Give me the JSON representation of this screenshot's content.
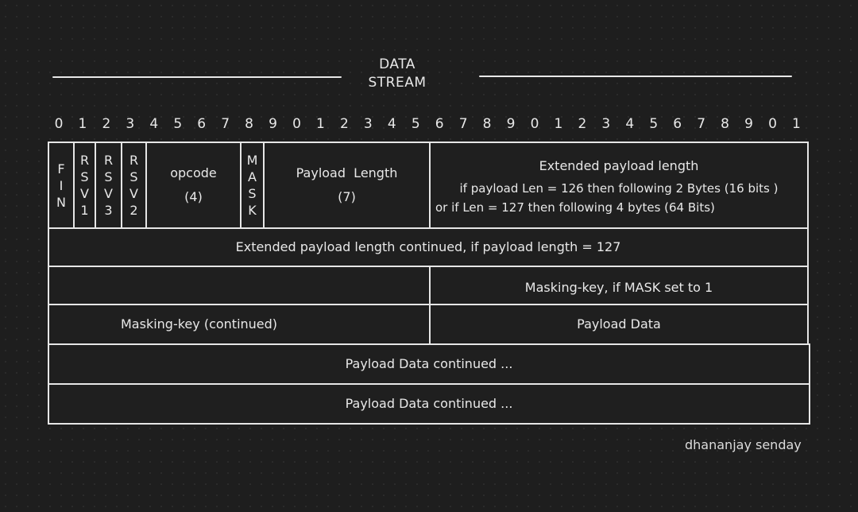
{
  "title": {
    "line1": "DATA",
    "line2": "STREAM"
  },
  "bit_labels": [
    "0",
    "1",
    "2",
    "3",
    "4",
    "5",
    "6",
    "7",
    "8",
    "9",
    "0",
    "1",
    "2",
    "3",
    "4",
    "5",
    "6",
    "7",
    "8",
    "9",
    "0",
    "1",
    "2",
    "3",
    "4",
    "5",
    "6",
    "7",
    "8",
    "9",
    "0",
    "1"
  ],
  "row1": {
    "fin": [
      "F",
      "I",
      "N"
    ],
    "rsv1": [
      "R",
      "S",
      "V",
      "1"
    ],
    "rsv3": [
      "R",
      "S",
      "V",
      "3"
    ],
    "rsv2": [
      "R",
      "S",
      "V",
      "2"
    ],
    "opcode": {
      "name": "opcode",
      "bits": "(4)"
    },
    "mask": [
      "M",
      "A",
      "S",
      "K"
    ],
    "payload_length": {
      "name": "Payload  Length",
      "bits": "(7)"
    },
    "extended": {
      "title": "Extended payload length",
      "line1": "if payload Len = 126 then following 2 Bytes (16 bits )",
      "line2": "or if Len = 127 then following 4 bytes (64 Bits)"
    }
  },
  "row2": {
    "text": "Extended payload length continued, if payload length = 127"
  },
  "row3": {
    "left": "",
    "right": "Masking-key, if MASK set to 1"
  },
  "row4": {
    "left": "Masking-key (continued)",
    "right": "Payload Data"
  },
  "row5": {
    "text": "Payload Data continued ..."
  },
  "row6": {
    "text": "Payload Data continued ..."
  },
  "signature": "dhananjay senday",
  "colors": {
    "background": "#1e1e1e",
    "stroke": "#e6e6e6",
    "text": "#e8e8e8"
  }
}
